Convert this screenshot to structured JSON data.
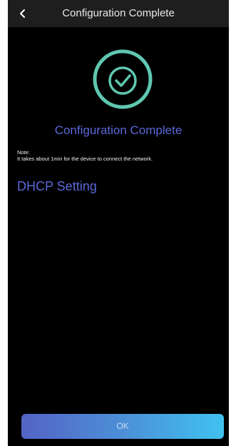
{
  "header": {
    "title": "Configuration Complete",
    "back_icon": "chevron-left-icon"
  },
  "status": {
    "icon": "check-circle-icon",
    "icon_color": "#5fc7b0",
    "title": "Configuration Complete"
  },
  "note": {
    "label": "Note:",
    "text": "It takes about 1min for the device to connect the network."
  },
  "dhcp": {
    "label": "DHCP Setting"
  },
  "footer": {
    "ok_label": "OK"
  },
  "colors": {
    "background": "#000000",
    "header_background": "#1e1e1e",
    "accent_text": "#5a68d8",
    "button_gradient_start": "#5364c4",
    "button_gradient_end": "#40c2ef"
  }
}
